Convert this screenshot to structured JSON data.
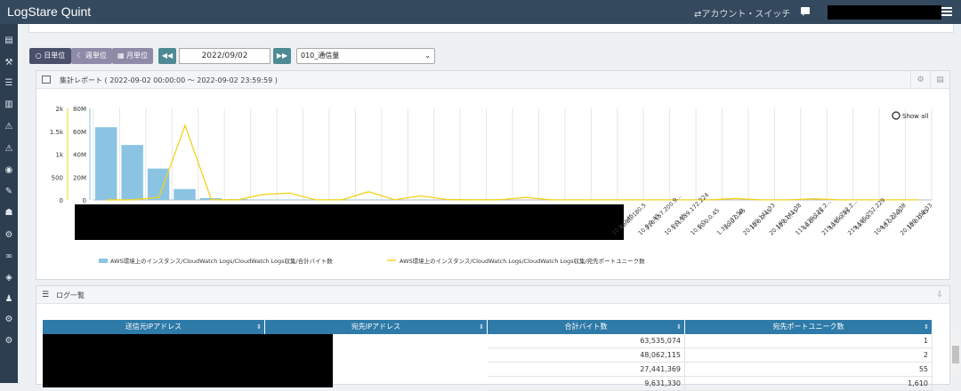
{
  "app": {
    "title": "LogStare Quint",
    "account_switch": "⇄アカウント・スイッチ"
  },
  "toolbar": {
    "day_label": "日単位",
    "week_label": "週単位",
    "month_label": "月単位",
    "date_value": "2022/09/02",
    "report_select": "010_通信量"
  },
  "report_panel": {
    "title": "集計レポート ( 2022-09-02 00:00:00 ～ 2022-09-02 23:59:59 )",
    "show_all": "Show all"
  },
  "chart_data": {
    "type": "bar",
    "left_axis_ticks": [
      "2k",
      "1.5k",
      "1k",
      "500",
      "0"
    ],
    "right_axis_ticks": [
      "80M",
      "60M",
      "40M",
      "20M",
      "0"
    ],
    "ylim_left": [
      0,
      2000
    ],
    "ylim_right": [
      0,
      80000000
    ],
    "series": [
      {
        "name": "AWS環境上のインスタンス/CloudWatch Logs/CloudWatch Logs収集/合計バイト数",
        "kind": "bar",
        "color": "#8bc4e2",
        "values": [
          63535074,
          48062115,
          27441369,
          9500000,
          1600000,
          700000,
          400000,
          300000,
          300000,
          300000,
          250000,
          200000,
          150000,
          120000,
          100000,
          80000,
          60000,
          50000,
          40000,
          30000,
          30000,
          25000,
          20000,
          20000,
          15000,
          15000,
          10000,
          10000,
          10000,
          10000,
          8000,
          8000
        ]
      },
      {
        "name": "AWS環境上のインスタンス/CloudWatch Logs/CloudWatch Logs収集/宛先ポートユニーク数",
        "kind": "line",
        "color": "#f2d31b",
        "values": [
          1,
          2,
          55,
          1630,
          8,
          3,
          120,
          150,
          3,
          4,
          180,
          5,
          90,
          10,
          4,
          5,
          55,
          3,
          3,
          2,
          3,
          2,
          2,
          3,
          30,
          3,
          2,
          25,
          3,
          2,
          3,
          2
        ]
      }
    ],
    "x_labels_visible": [
      "10.0.0.45",
      "40.80.180.5",
      "10.0.0.45",
      "210.157.200.9...",
      "10.0.0.45",
      "111.239.172.224",
      "10.0.0...",
      "10.0.0.45",
      "1.33.137.50",
      "10.0.0.45",
      "20.190.141.33",
      "10.0.0.45",
      "20.190.141.38",
      "10.0.0.45",
      "111.239.172.2...",
      "10.0.0.45",
      "219.165.252.2...",
      "10.0.0.45",
      "219.165.252.229",
      "10.0.0...",
      "104.47.23.138",
      "10.0.0.45",
      "20.190.160.33",
      "10.0.0.45"
    ]
  },
  "log_panel": {
    "title": "ログ一覧",
    "columns": [
      "送信元IPアドレス",
      "宛先IPアドレス",
      "合計バイト数",
      "宛先ポートユニーク数"
    ],
    "rows": [
      {
        "bytes": "63,535,074",
        "ports": "1"
      },
      {
        "bytes": "48,062,115",
        "ports": "2"
      },
      {
        "bytes": "27,441,369",
        "ports": "55"
      },
      {
        "bytes": "9,631,330",
        "ports": "1,610"
      }
    ]
  }
}
